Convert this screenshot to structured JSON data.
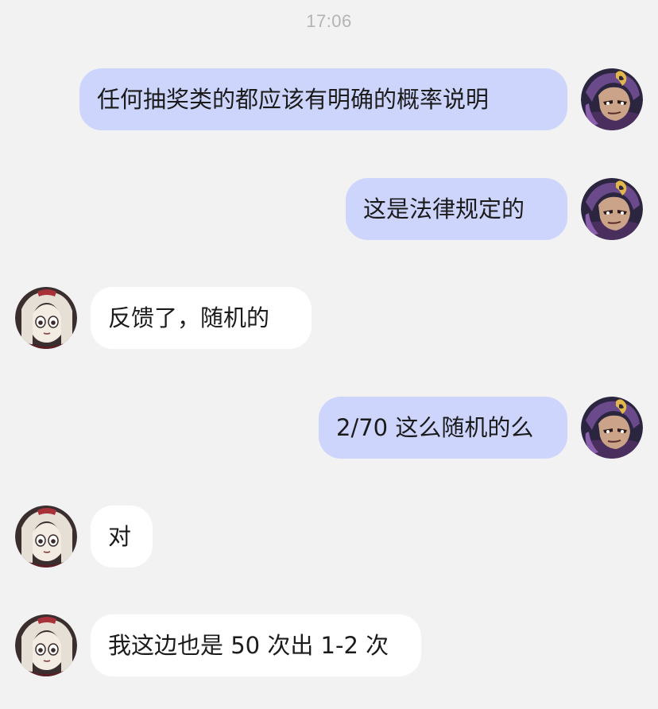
{
  "chat": {
    "timestamp": "17:06",
    "messages": [
      {
        "side": "out",
        "text": "任何抽奖类的都应该有明确的概率说明"
      },
      {
        "side": "out",
        "text": "这是法律规定的"
      },
      {
        "side": "in",
        "text": "反馈了，随机的"
      },
      {
        "side": "out",
        "text": "2/70 这么随机的么"
      },
      {
        "side": "in",
        "text": "对"
      },
      {
        "side": "in",
        "text": "我这边也是 50 次出 1-2 次"
      }
    ]
  },
  "colors": {
    "background": "#f2f2f2",
    "outgoing_bubble": "#cdd5fc",
    "incoming_bubble": "#ffffff",
    "timestamp_text": "#b4b4b4"
  },
  "icons": {
    "self_avatar": "dark-haired-character-avatar",
    "other_avatar": "pale-haired-character-avatar"
  }
}
